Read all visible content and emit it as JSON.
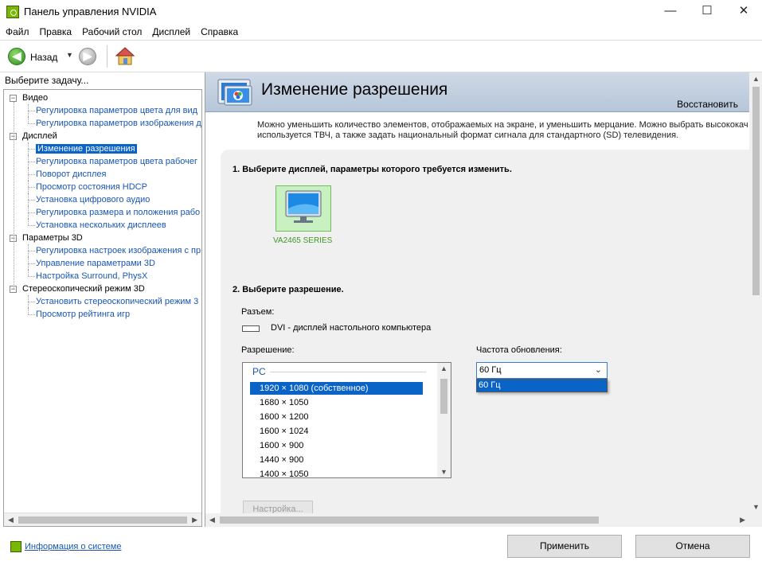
{
  "window": {
    "title": "Панель управления NVIDIA",
    "minimize": "—",
    "maximize": "☐",
    "close": "✕"
  },
  "menu": [
    "Файл",
    "Правка",
    "Рабочий стол",
    "Дисплей",
    "Справка"
  ],
  "toolbar": {
    "back_label": "Назад"
  },
  "left": {
    "header": "Выберите задачу...",
    "tree": [
      {
        "label": "Видео",
        "kind": "cat"
      },
      {
        "label": "Регулировка параметров цвета для вид",
        "kind": "link"
      },
      {
        "label": "Регулировка параметров изображения д",
        "kind": "link"
      },
      {
        "label": "Дисплей",
        "kind": "cat"
      },
      {
        "label": "Изменение разрешения",
        "kind": "link",
        "selected": true
      },
      {
        "label": "Регулировка параметров цвета рабочег",
        "kind": "link"
      },
      {
        "label": "Поворот дисплея",
        "kind": "link"
      },
      {
        "label": "Просмотр состояния HDCP",
        "kind": "link"
      },
      {
        "label": "Установка цифрового аудио",
        "kind": "link"
      },
      {
        "label": "Регулировка размера и положения рабо",
        "kind": "link"
      },
      {
        "label": "Установка нескольких дисплеев",
        "kind": "link"
      },
      {
        "label": "Параметры 3D",
        "kind": "cat"
      },
      {
        "label": "Регулировка настроек изображения с пр",
        "kind": "link"
      },
      {
        "label": "Управление параметрами 3D",
        "kind": "link"
      },
      {
        "label": "Настройка Surround, PhysX",
        "kind": "link"
      },
      {
        "label": "Стереоскопический режим 3D",
        "kind": "cat"
      },
      {
        "label": "Установить стереоскопический режим 3",
        "kind": "link"
      },
      {
        "label": "Просмотр рейтинга игр",
        "kind": "link"
      }
    ]
  },
  "main": {
    "title": "Изменение разрешения",
    "restore": "Восстановить",
    "intro_line1": "Можно уменьшить количество элементов, отображаемых на экране, и уменьшить мерцание. Можно выбрать высококач",
    "intro_line2": "используется ТВЧ, а также задать национальный формат сигнала для стандартного (SD) телевидения.",
    "step1": "1. Выберите дисплей, параметры которого требуется изменить.",
    "display_name": "VA2465 SERIES",
    "step2": "2. Выберите разрешение.",
    "connector_label": "Разъем:",
    "connector_value": "DVI - дисплей настольного компьютера",
    "resolution_label": "Разрешение:",
    "resolution_group": "PC",
    "resolutions": [
      "1920 × 1080 (собственное)",
      "1680 × 1050",
      "1600 × 1200",
      "1600 × 1024",
      "1600 × 900",
      "1440 × 900",
      "1400 × 1050"
    ],
    "selected_resolution_index": 0,
    "refresh_label": "Частота обновления:",
    "refresh_value": "60 Гц",
    "refresh_options": [
      "60 Гц"
    ],
    "setup_button": "Настройка..."
  },
  "bottom": {
    "sysinfo": "Информация о системе",
    "apply": "Применить",
    "cancel": "Отмена"
  }
}
